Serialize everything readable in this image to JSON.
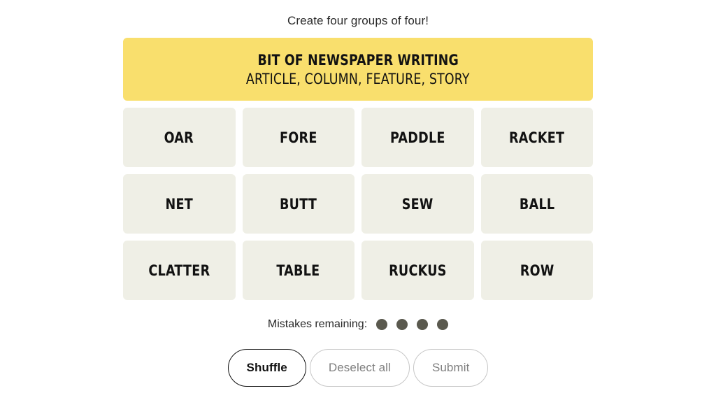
{
  "header": {
    "instruction": "Create four groups of four!"
  },
  "board": {
    "solved_groups": [
      {
        "title": "BIT OF NEWSPAPER WRITING",
        "members": "ARTICLE, COLUMN, FEATURE, STORY",
        "color": "#f9df6d"
      }
    ],
    "rows": [
      [
        {
          "label": "OAR"
        },
        {
          "label": "FORE"
        },
        {
          "label": "PADDLE"
        },
        {
          "label": "RACKET"
        }
      ],
      [
        {
          "label": "NET"
        },
        {
          "label": "BUTT"
        },
        {
          "label": "SEW"
        },
        {
          "label": "BALL"
        }
      ],
      [
        {
          "label": "CLATTER"
        },
        {
          "label": "TABLE"
        },
        {
          "label": "RUCKUS"
        },
        {
          "label": "ROW"
        }
      ]
    ],
    "tile_color": "#efefe6"
  },
  "mistakes": {
    "label": "Mistakes remaining:",
    "remaining": 4,
    "dot_color": "#5a594e"
  },
  "actions": {
    "shuffle": {
      "label": "Shuffle",
      "state": "enabled"
    },
    "deselect_all": {
      "label": "Deselect all",
      "state": "disabled"
    },
    "submit": {
      "label": "Submit",
      "state": "disabled"
    }
  }
}
